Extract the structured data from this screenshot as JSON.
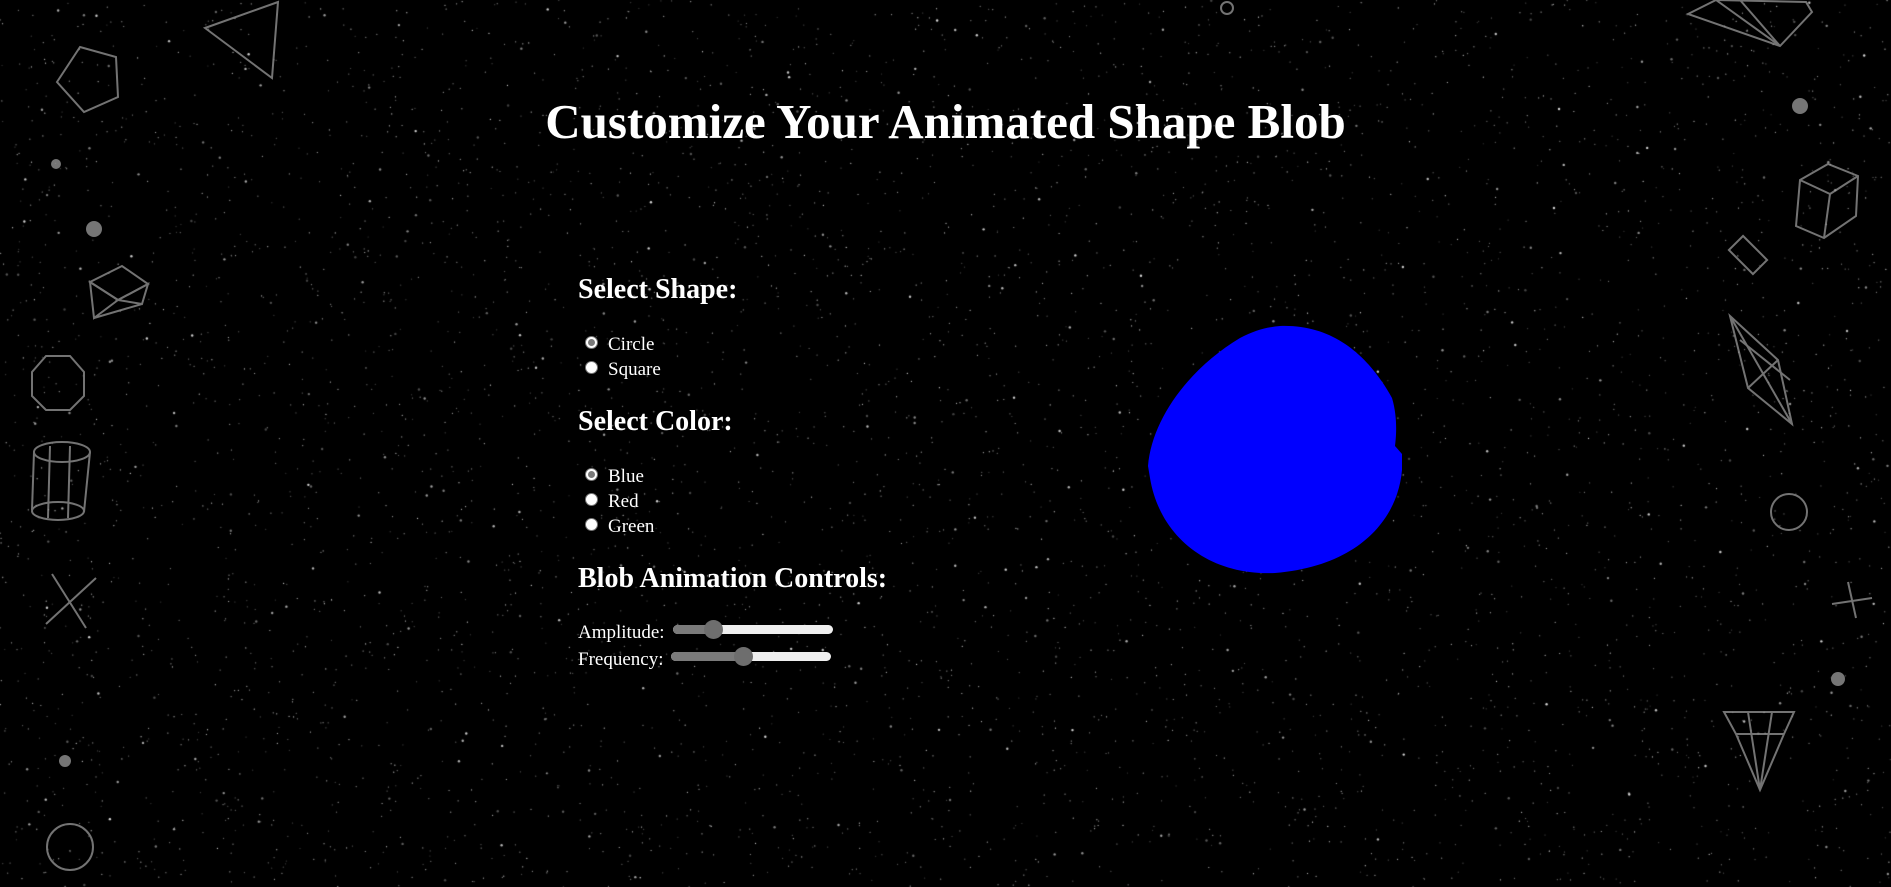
{
  "page": {
    "title": "Customize Your Animated Shape Blob"
  },
  "shape_section": {
    "heading": "Select Shape:",
    "options": [
      {
        "label": "Circle",
        "checked": true
      },
      {
        "label": "Square",
        "checked": false
      }
    ]
  },
  "color_section": {
    "heading": "Select Color:",
    "options": [
      {
        "label": "Blue",
        "checked": true
      },
      {
        "label": "Red",
        "checked": false
      },
      {
        "label": "Green",
        "checked": false
      }
    ]
  },
  "animation_section": {
    "heading": "Blob Animation Controls:",
    "amplitude": {
      "label": "Amplitude:",
      "value_fraction": 0.25
    },
    "frequency": {
      "label": "Frequency:",
      "value_fraction": 0.45
    }
  },
  "blob": {
    "color": "#0000ff"
  },
  "background": {
    "color": "#000000",
    "star_color": "#ffffff",
    "decoration_color": "#9a9a9a"
  }
}
